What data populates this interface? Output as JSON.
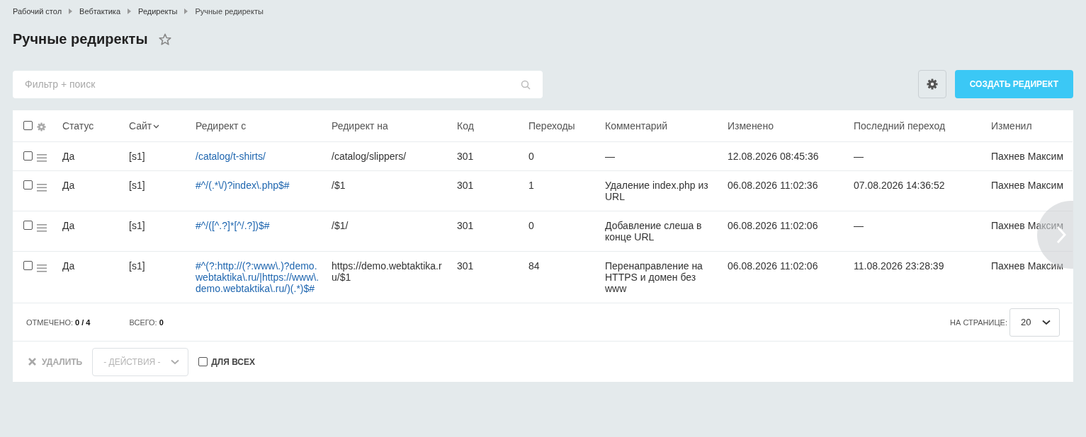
{
  "breadcrumbs": [
    "Рабочий стол",
    "Вебтактика",
    "Редиректы",
    "Ручные редиректы"
  ],
  "title": "Ручные редиректы",
  "favorite": false,
  "filter": {
    "placeholder": "Фильтр + поиск"
  },
  "create_button": "СОЗДАТЬ РЕДИРЕКТ",
  "select_all": {
    "checked": false
  },
  "columns": [
    {
      "label": "Статус",
      "sorted": false
    },
    {
      "label": "Сайт",
      "sorted": true
    },
    {
      "label": "Редирект с",
      "sorted": false
    },
    {
      "label": "Редирект на",
      "sorted": false
    },
    {
      "label": "Код",
      "sorted": false
    },
    {
      "label": "Переходы",
      "sorted": false
    },
    {
      "label": "Комментарий",
      "sorted": false
    },
    {
      "label": "Изменено",
      "sorted": false
    },
    {
      "label": "Последний переход",
      "sorted": false
    },
    {
      "label": "Изменил",
      "sorted": false
    }
  ],
  "rows": [
    {
      "checked": false,
      "status": "Да",
      "site": "[s1]",
      "from": "/catalog/t-shirts/",
      "to": "/catalog/slippers/",
      "code": "301",
      "hits": "0",
      "comment": "—",
      "changed": "12.08.2026 08:45:36",
      "last": "—",
      "author": "Пахнев Максим"
    },
    {
      "checked": false,
      "status": "Да",
      "site": "[s1]",
      "from": "#^/(.*\\/)?index\\.php$#",
      "to": "/$1",
      "code": "301",
      "hits": "1",
      "comment": "Удаление index.php из URL",
      "changed": "06.08.2026 11:02:36",
      "last": "07.08.2026 14:36:52",
      "author": "Пахнев Максим"
    },
    {
      "checked": false,
      "status": "Да",
      "site": "[s1]",
      "from": "#^/([^.?]*[^/.?])$#",
      "to": "/$1/",
      "code": "301",
      "hits": "0",
      "comment": "Добавление слеша в конце URL",
      "changed": "06.08.2026 11:02:06",
      "last": "—",
      "author": "Пахнев Максим"
    },
    {
      "checked": false,
      "status": "Да",
      "site": "[s1]",
      "from": "#^(?:http://(?:www\\.)?demo.webtaktika\\.ru/|https://www\\.demo.webtaktika\\.ru/)(.*)$#",
      "to": "https://demo.webtaktika.ru/$1",
      "code": "301",
      "hits": "84",
      "comment": "Перенаправление на HTTPS и домен без www",
      "changed": "06.08.2026 11:02:06",
      "last": "11.08.2026 23:28:39",
      "author": "Пахнев Максим"
    }
  ],
  "footer": {
    "selected_label": "ОТМЕЧЕНО:",
    "selected_value": "0 / 4",
    "total_label": "ВСЕГО:",
    "total_value": "0",
    "per_page_label": "НА СТРАНИЦЕ:",
    "per_page_value": "20"
  },
  "actions": {
    "delete": "УДАЛИТЬ",
    "actions_placeholder": "- ДЕЙСТВИЯ -",
    "for_all": "ДЛЯ ВСЕХ",
    "for_all_checked": false
  }
}
